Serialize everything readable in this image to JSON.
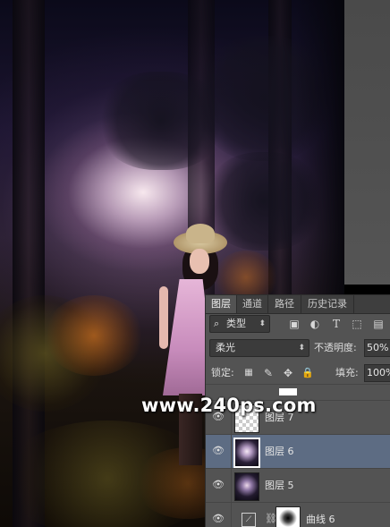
{
  "watermark": "www.240ps.com",
  "panel": {
    "tabs": [
      "图层",
      "通道",
      "路径",
      "历史记录"
    ],
    "filter_kind": "类型",
    "blend_mode": "柔光",
    "opacity_label": "不透明度:",
    "opacity_value": "50%",
    "lock_label": "锁定:",
    "fill_label": "填充:",
    "fill_value": "100%",
    "layers": [
      {
        "name": "图层 7",
        "selected": false
      },
      {
        "name": "图层 6",
        "selected": true
      },
      {
        "name": "图层 5",
        "selected": false
      },
      {
        "name": "曲线 6",
        "selected": false
      }
    ]
  },
  "colors": {
    "panel_bg": "#535353",
    "tab_bar": "#3e3e3e",
    "selected_row": "#5d6c83"
  },
  "icons": {
    "filter": "search-icon",
    "filter_buttons": [
      "image-filter-icon",
      "adjustment-filter-icon",
      "type-filter-icon",
      "shape-filter-icon",
      "smart-object-filter-icon"
    ],
    "locks": [
      "lock-transparent-icon",
      "lock-paint-icon",
      "lock-move-icon",
      "lock-all-icon"
    ]
  }
}
